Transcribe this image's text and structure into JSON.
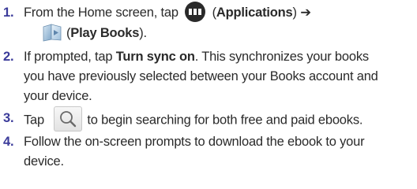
{
  "steps": [
    {
      "number": "1.",
      "line1_pre": "From the Home screen, tap ",
      "line1_post_paren": "(",
      "line1_bold": "Applications",
      "line1_close": ") ➔",
      "line2_paren": "(",
      "line2_bold": "Play Books",
      "line2_close": ")."
    },
    {
      "number": "2.",
      "line1_pre": "If prompted, tap ",
      "line1_bold": "Turn sync on",
      "line1_post": ". This synchronizes your books",
      "line2": "you have previously selected between your Books account and",
      "line3": "your device."
    },
    {
      "number": "3.",
      "pre": "Tap ",
      "post": "to begin searching for both free and paid ebooks."
    },
    {
      "number": "4.",
      "line1": "Follow the on-screen prompts to download the ebook to your",
      "line2": "device."
    }
  ],
  "icons": {
    "applications": "apps-grid-icon",
    "play_books": "play-books-icon",
    "search": "search-icon"
  }
}
